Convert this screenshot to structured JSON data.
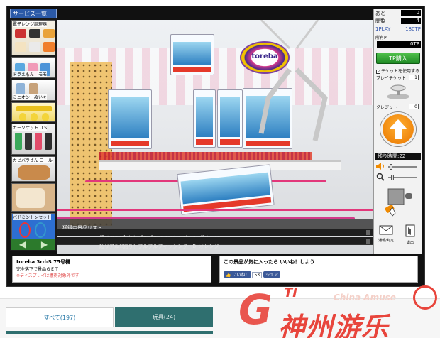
{
  "sidebar": {
    "title": "サービス一覧",
    "items": [
      {
        "label": "電子レンジ調理器"
      },
      {
        "label": "ドラえもん　モモ"
      },
      {
        "label": "ミニオン　ぬいぐ"
      },
      {
        "label": ""
      },
      {
        "label": "カーソケット U S"
      },
      {
        "label": "カピバラさん コール"
      },
      {
        "label": "バドミントンセット"
      }
    ],
    "nav_prev": "◀",
    "nav_next": "▶"
  },
  "game": {
    "logo_text": "toreba",
    "list_header": "獲得中景品リスト",
    "list_rows": [
      "超リアル!!釣り！ブルブルフィッシング　A. グリーン",
      "超リアル!!釣り！ブルブルフィッシング　B. オレンジ"
    ]
  },
  "right_panel": {
    "remaining_label": "あと",
    "remaining_value": "0",
    "waiting_label": "閲覧",
    "waiting_value": "4",
    "play_label": "1PLAY",
    "play_value": "180TP",
    "owned_label": "所有P",
    "owned_value": "0TP",
    "buy_button": "TP購入",
    "use_ticket_label": "チケットを使用する",
    "play_ticket_label": "プレイチケット",
    "play_ticket_value": "1",
    "credit_label": "クレジット",
    "credit_value": "0",
    "timer_label": "残り時間:22",
    "mail_label": "通報/判定",
    "exit_label": "退出"
  },
  "info_left": {
    "title": "toreba 3rd-S 75号機",
    "subtitle": "完全落下で景品ＧＥＴ！",
    "note": "※ディスプレイは獲得対象外です"
  },
  "info_right": {
    "prompt": "この景品が気に入ったら いいね！しよう",
    "like_button": "いいね！",
    "like_count": "53",
    "share_button": "シェア"
  },
  "tabs": [
    {
      "label": "すべて(197)"
    },
    {
      "label": "玩具(24)"
    }
  ],
  "watermark": {
    "logo_letter": "G",
    "logo_ti": "TI",
    "english": "China Amuse",
    "chinese": "神州游乐"
  },
  "colors": {
    "accent_green": "#1f8a25",
    "accent_orange": "#e97500",
    "tab_active": "#2f6f6f",
    "watermark_red": "#e8453c"
  }
}
